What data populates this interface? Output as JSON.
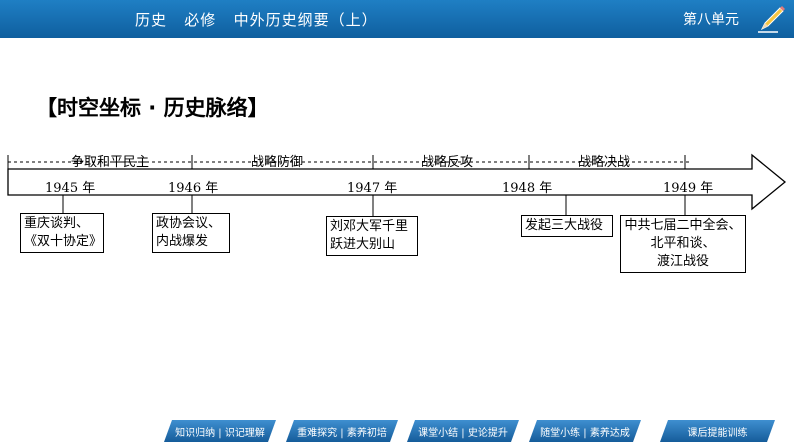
{
  "header": {
    "title": "历史   必修   中外历史纲要（上）",
    "unit": "第八单元",
    "colors": {
      "bar": "#1a72b8",
      "text": "#ffffff"
    }
  },
  "section_title": "【时空坐标 · 历史脉络】",
  "timeline": {
    "phases": [
      "争取和平民主",
      "战略防御",
      "战略反攻",
      "战略决战"
    ],
    "years": [
      "1945 年",
      "1946 年",
      "1947 年",
      "1948 年",
      "1949 年"
    ],
    "events": [
      {
        "lines": [
          "重庆谈判、",
          "《双十协定》"
        ]
      },
      {
        "lines": [
          "政协会议、",
          "内战爆发"
        ]
      },
      {
        "lines": [
          "刘邓大军千里",
          "跃进大别山"
        ]
      },
      {
        "lines": [
          "发起三大战役"
        ]
      },
      {
        "lines": [
          "中共七届二中全会、",
          "北平和谈、",
          "渡江战役"
        ]
      }
    ]
  },
  "footer_nav": [
    "知识归纳 | 识记理解",
    "重难探究 | 素养初培",
    "课堂小结 | 史论提升",
    "随堂小练 | 素养达成",
    "课后提能训练"
  ]
}
